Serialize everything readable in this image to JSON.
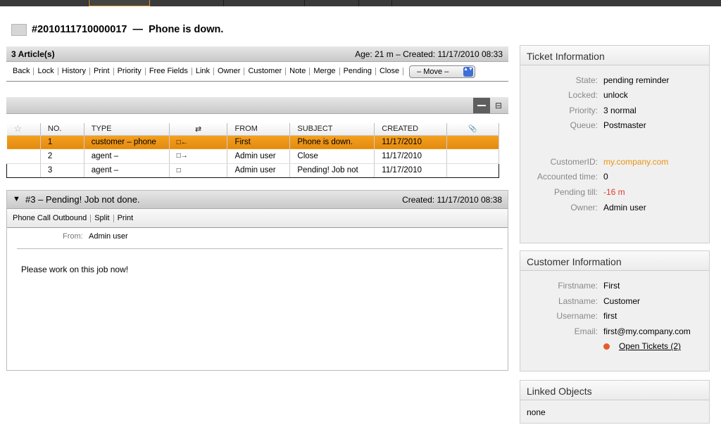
{
  "ticket": {
    "number": "#2010111710000017",
    "dash": "—",
    "title": "Phone is down."
  },
  "articles_header": {
    "count": "3 Article(s)",
    "age": "Age: 21 m – Created: 11/17/2010 08:33"
  },
  "ticket_actions": [
    "Back",
    "Lock",
    "History",
    "Print",
    "Priority",
    "Free Fields",
    "Link",
    "Owner",
    "Customer",
    "Note",
    "Merge",
    "Pending",
    "Close"
  ],
  "move_select": {
    "value": "– Move –",
    "arrows": "▲▼"
  },
  "table": {
    "star": "☆",
    "columns": [
      "NO.",
      "TYPE",
      "⇄",
      "FROM",
      "SUBJECT",
      "CREATED",
      "📎"
    ],
    "rows": [
      {
        "no": "1",
        "type": "customer – phone",
        "dir": "□←",
        "from": "First",
        "subject": "Phone is down.",
        "created": "11/17/2010"
      },
      {
        "no": "2",
        "type": "agent –",
        "dir": "□→",
        "from": "Admin user",
        "subject": "Close",
        "created": "11/17/2010"
      },
      {
        "no": "3",
        "type": "agent –",
        "dir": "□",
        "from": "Admin user",
        "subject": "Pending! Job not",
        "created": "11/17/2010"
      }
    ]
  },
  "article": {
    "toggle": "▼",
    "subject": "#3 – Pending! Job not done.",
    "created": "Created: 11/17/2010 08:38",
    "actions": [
      "Phone Call Outbound",
      "Split",
      "Print"
    ],
    "from_label": "From:",
    "from_value": "Admin user",
    "body": "Please work on this job now!"
  },
  "ticket_info": {
    "heading": "Ticket Information",
    "state_label": "State:",
    "state": "pending reminder",
    "locked_label": "Locked:",
    "locked": "unlock",
    "priority_label": "Priority:",
    "priority": "3 normal",
    "queue_label": "Queue:",
    "queue": "Postmaster",
    "customerid_label": "CustomerID:",
    "customerid": "my.company.com",
    "accounted_label": "Accounted time:",
    "accounted": "0",
    "pending_label": "Pending till:",
    "pending": "-16 m",
    "owner_label": "Owner:",
    "owner": "Admin user"
  },
  "customer_info": {
    "heading": "Customer Information",
    "firstname_label": "Firstname:",
    "firstname": "First",
    "lastname_label": "Lastname:",
    "lastname": "Customer",
    "username_label": "Username:",
    "username": "first",
    "email_label": "Email:",
    "email": "first@my.company.com",
    "open_tickets": "Open Tickets (2)"
  },
  "linked_objects": {
    "heading": "Linked Objects",
    "value": "none"
  },
  "colors": {
    "accent": "#e8940f",
    "selected_row": "#f19a1a",
    "warning": "#e03c28"
  }
}
